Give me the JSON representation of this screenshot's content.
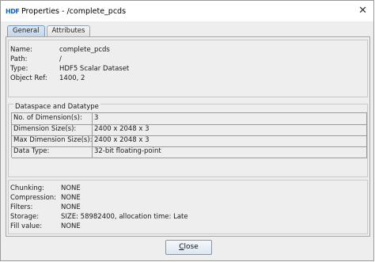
{
  "window": {
    "title": "Properties - /complete_pcds",
    "app_icon_text": "HDF"
  },
  "tabs": [
    {
      "label": "General"
    },
    {
      "label": "Attributes"
    }
  ],
  "general": [
    {
      "key": "Name:",
      "value": "complete_pcds"
    },
    {
      "key": "Path:",
      "value": "/"
    },
    {
      "key": "Type:",
      "value": "HDF5 Scalar Dataset"
    },
    {
      "key": "Object Ref:",
      "value": "1400, 2"
    }
  ],
  "dataspace": {
    "title": "Dataspace and Datatype",
    "rows": [
      {
        "label": "No. of Dimension(s):",
        "value": "3"
      },
      {
        "label": "Dimension Size(s):",
        "value": "2400 x 2048 x 3"
      },
      {
        "label": "Max Dimension Size(s):",
        "value": "2400 x 2048 x 3"
      },
      {
        "label": "Data Type:",
        "value": "32-bit floating-point"
      }
    ]
  },
  "storage": [
    {
      "key": "Chunking:",
      "value": "NONE"
    },
    {
      "key": "Compression:",
      "value": "NONE"
    },
    {
      "key": "Filters:",
      "value": "NONE"
    },
    {
      "key": "Storage:",
      "value": "SIZE: 58982400, allocation time: Late"
    },
    {
      "key": "Fill value:",
      "value": "NONE"
    }
  ],
  "buttons": {
    "close_first": "C",
    "close_rest": "lose"
  }
}
